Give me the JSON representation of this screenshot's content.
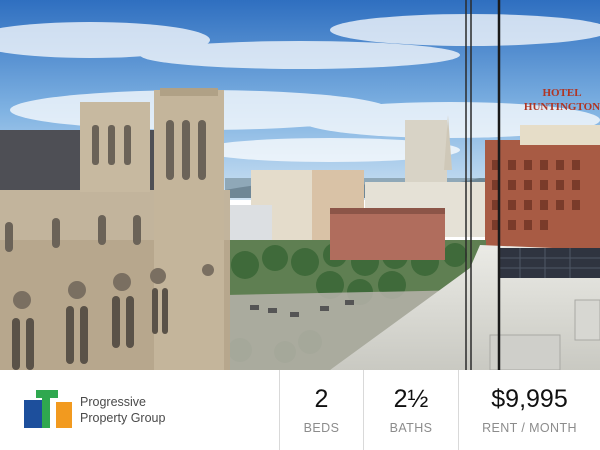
{
  "photo": {
    "hotel_sign_line1": "HOTEL",
    "hotel_sign_line2": "HUNTINGTON"
  },
  "brand": {
    "name_line1": "Progressive",
    "name_line2": "Property Group",
    "logo_icon": "progressive-logo-icon",
    "colors": {
      "blue": "#1d4f9c",
      "green": "#2fa84f",
      "orange": "#f29a1f"
    }
  },
  "stats": {
    "beds": {
      "value": "2",
      "label": "BEDS"
    },
    "baths": {
      "value": "2½",
      "label": "BATHS"
    },
    "rent": {
      "value": "$9,995",
      "label": "RENT / MONTH"
    }
  }
}
